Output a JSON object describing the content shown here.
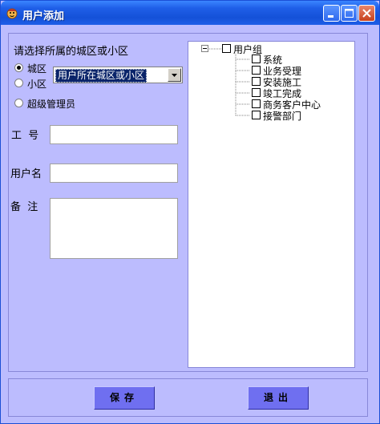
{
  "window": {
    "title": "用户添加"
  },
  "form": {
    "prompt": "请选择所属的城区或小区",
    "radios": [
      {
        "label": "城区",
        "checked": true
      },
      {
        "label": "小区",
        "checked": false
      },
      {
        "label": "超级管理员",
        "checked": false
      }
    ],
    "area_select": {
      "value": "用户所在城区或小区"
    },
    "employee_no_label": "工  号",
    "employee_no_value": "",
    "username_label": "用户名",
    "username_value": "",
    "remark_label": "备  注",
    "remark_value": ""
  },
  "tree": {
    "root": {
      "label": "用户组",
      "checked": false,
      "expanded": true
    },
    "children": [
      {
        "label": "系统",
        "checked": false
      },
      {
        "label": "业务受理",
        "checked": false
      },
      {
        "label": "安装施工",
        "checked": false
      },
      {
        "label": "竣工完成",
        "checked": false
      },
      {
        "label": "商务客户中心",
        "checked": false
      },
      {
        "label": "接警部门",
        "checked": false
      }
    ]
  },
  "actions": {
    "save_label": "保存",
    "exit_label": "退出"
  },
  "colors": {
    "background": "#bcbcfe",
    "button": "#6f6ff0",
    "titlebar": "#1451d8",
    "selection": "#0a246a"
  }
}
